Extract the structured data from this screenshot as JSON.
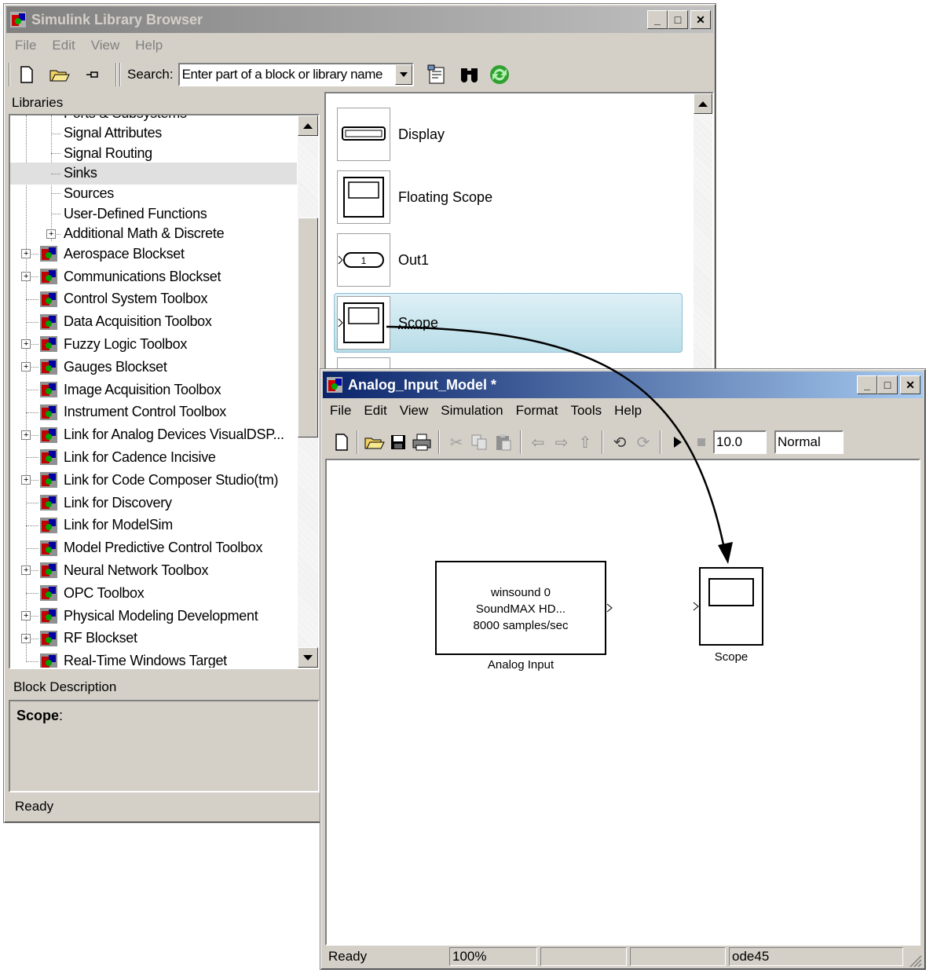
{
  "library_browser": {
    "title": "Simulink Library Browser",
    "menu": [
      "File",
      "Edit",
      "View",
      "Help"
    ],
    "search_label": "Search:",
    "search_placeholder": "Enter part of a block or library name",
    "libraries_label": "Libraries",
    "tree_items": [
      {
        "label": "Ports & Subsystems",
        "level": 2,
        "expander": false
      },
      {
        "label": "Signal Attributes",
        "level": 2,
        "expander": false
      },
      {
        "label": "Signal Routing",
        "level": 2,
        "expander": false
      },
      {
        "label": "Sinks",
        "level": 2,
        "expander": false,
        "selected": true
      },
      {
        "label": "Sources",
        "level": 2,
        "expander": false
      },
      {
        "label": "User-Defined Functions",
        "level": 2,
        "expander": false
      },
      {
        "label": "Additional Math & Discrete",
        "level": 2,
        "expander": true
      },
      {
        "label": "Aerospace Blockset",
        "level": 1,
        "expander": true
      },
      {
        "label": "Communications Blockset",
        "level": 1,
        "expander": true
      },
      {
        "label": "Control System Toolbox",
        "level": 1,
        "expander": false
      },
      {
        "label": "Data Acquisition Toolbox",
        "level": 1,
        "expander": false
      },
      {
        "label": "Fuzzy Logic Toolbox",
        "level": 1,
        "expander": true
      },
      {
        "label": "Gauges Blockset",
        "level": 1,
        "expander": true
      },
      {
        "label": "Image Acquisition Toolbox",
        "level": 1,
        "expander": false
      },
      {
        "label": "Instrument Control Toolbox",
        "level": 1,
        "expander": false
      },
      {
        "label": "Link for Analog Devices VisualDSP...",
        "level": 1,
        "expander": true
      },
      {
        "label": "Link for Cadence Incisive",
        "level": 1,
        "expander": false
      },
      {
        "label": "Link for Code Composer Studio(tm)",
        "level": 1,
        "expander": true
      },
      {
        "label": "Link for Discovery",
        "level": 1,
        "expander": false
      },
      {
        "label": "Link for ModelSim",
        "level": 1,
        "expander": false
      },
      {
        "label": "Model Predictive Control Toolbox",
        "level": 1,
        "expander": false
      },
      {
        "label": "Neural Network Toolbox",
        "level": 1,
        "expander": true
      },
      {
        "label": "OPC Toolbox",
        "level": 1,
        "expander": false
      },
      {
        "label": "Physical Modeling Development",
        "level": 1,
        "expander": true
      },
      {
        "label": "RF Blockset",
        "level": 1,
        "expander": true
      },
      {
        "label": "Real-Time Windows Target",
        "level": 1,
        "expander": false
      }
    ],
    "blocks": [
      "Display",
      "Floating Scope",
      "Out1",
      "Scope"
    ],
    "out1_port": "1",
    "block_description_label": "Block Description",
    "description_title": "Scope",
    "description_colon": ":",
    "status": "Ready"
  },
  "model_window": {
    "title": "Analog_Input_Model *",
    "menu": [
      "File",
      "Edit",
      "View",
      "Simulation",
      "Format",
      "Tools",
      "Help"
    ],
    "stop_time": "10.0",
    "sim_mode": "Normal",
    "analog_block": {
      "lines": [
        "winsound 0",
        "SoundMAX HD...",
        "8000 samples/sec"
      ],
      "caption": "Analog Input"
    },
    "scope_block": {
      "caption": "Scope"
    },
    "status": {
      "ready": "Ready",
      "zoom": "100%",
      "solver": "ode45"
    }
  },
  "colors": {
    "selected_block_bg": "#cce8f0",
    "active_title": "#0a246a",
    "inactive_title": "#808080"
  }
}
